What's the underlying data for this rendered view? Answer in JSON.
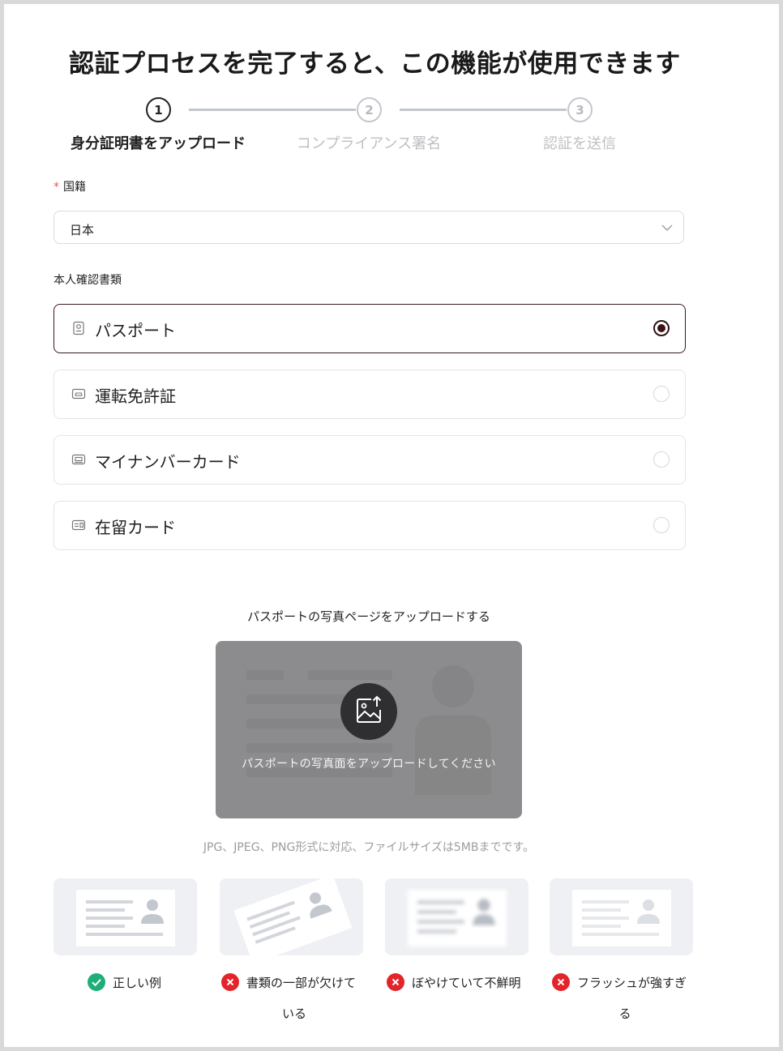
{
  "title": "認証プロセスを完了すると、この機能が使用できます",
  "steps": [
    {
      "number": "1",
      "label": "身分証明書をアップロード",
      "state": "active"
    },
    {
      "number": "2",
      "label": "コンプライアンス署名",
      "state": "inactive"
    },
    {
      "number": "3",
      "label": "認証を送信",
      "state": "inactive"
    }
  ],
  "nationality": {
    "required_mark": "*",
    "label": "国籍",
    "value": "日本"
  },
  "id_type": {
    "label": "本人確認書類",
    "options": [
      {
        "label": "パスポート",
        "icon": "passport-icon",
        "selected": true
      },
      {
        "label": "運転免許証",
        "icon": "car-license-icon",
        "selected": false
      },
      {
        "label": "マイナンバーカード",
        "icon": "mynumber-card-icon",
        "selected": false
      },
      {
        "label": "在留カード",
        "icon": "residence-card-icon",
        "selected": false
      }
    ]
  },
  "upload": {
    "title": "パスポートの写真ページをアップロードする",
    "prompt": "パスポートの写真面をアップロードしてください",
    "hint": "JPG、JPEG、PNG形式に対応、ファイルサイズは5MBまでです。"
  },
  "examples": [
    {
      "line1": "正しい例",
      "line2": "",
      "status": "ok"
    },
    {
      "line1": "書類の一部が欠けて",
      "line2": "いる",
      "status": "bad"
    },
    {
      "line1": "ぼやけていて不鮮明",
      "line2": "",
      "status": "bad"
    },
    {
      "line1": "フラッシュが強すぎ",
      "line2": "る",
      "status": "bad"
    }
  ],
  "colors": {
    "accent": "#3d1216",
    "ok": "#1fae7a",
    "error": "#e3242b",
    "step_inactive": "#c3c6cb"
  }
}
